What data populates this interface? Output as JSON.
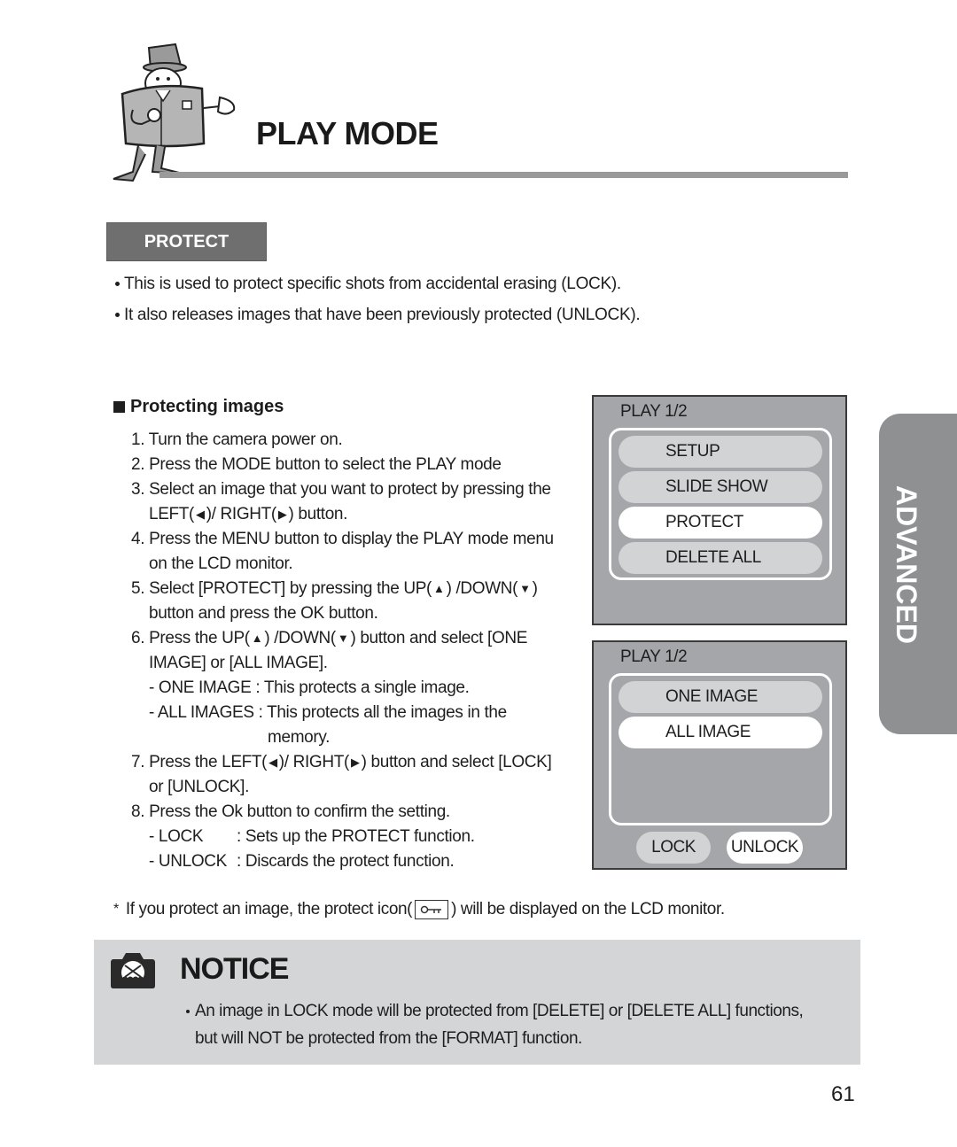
{
  "header": {
    "title": "PLAY MODE",
    "mascot_icon": "camera-mascot-icon"
  },
  "section": {
    "tab_label": "PROTECT",
    "intro": [
      "This is used to protect specific shots from accidental erasing (LOCK).",
      "It also releases images that have been previously protected (UNLOCK)."
    ]
  },
  "procedure": {
    "heading": "Protecting images",
    "steps": {
      "s1": "1. Turn the camera power on.",
      "s2": "2. Press the MODE button to select the PLAY mode",
      "s3a": "3. Select an image that you want to protect by pressing the",
      "s3b_1": "LEFT(",
      "s3b_2": ")/ RIGHT(",
      "s3b_3": ") button.",
      "s4a": "4. Press the MENU button to display the PLAY mode menu",
      "s4b": "on the LCD monitor.",
      "s5a_1": "5. Select [PROTECT] by pressing the UP(",
      "s5a_2": ") /DOWN(",
      "s5a_3": ")",
      "s5b": "button and press the OK button.",
      "s6a_1": "6. Press the UP(",
      "s6a_2": ") /DOWN(",
      "s6a_3": ") button and select [ONE",
      "s6b": "IMAGE] or [ALL IMAGE].",
      "s6c": "- ONE IMAGE : This protects a single image.",
      "s6d": "- ALL IMAGES : This protects all the images in the",
      "s6e": "memory.",
      "s7a_1": "7. Press the LEFT(",
      "s7a_2": ")/ RIGHT(",
      "s7a_3": ") button and select [LOCK]",
      "s7b": "or [UNLOCK].",
      "s8": "8. Press the Ok button to confirm the setting.",
      "s8_lock_key": "- LOCK",
      "s8_lock_val": ": Sets up the PROTECT function.",
      "s8_unlock_key": "- UNLOCK",
      "s8_unlock_val": ": Discards the protect function."
    },
    "glyphs": {
      "left": "◀",
      "right": "▶",
      "up": "▲",
      "down": "▼"
    }
  },
  "lcd_menu": {
    "title": "PLAY 1/2",
    "items": [
      "SETUP",
      "SLIDE SHOW",
      "PROTECT",
      "DELETE ALL"
    ],
    "selected": "PROTECT"
  },
  "lcd_protect": {
    "title": "PLAY 1/2",
    "items": [
      "ONE IMAGE",
      "ALL IMAGE"
    ],
    "selected": "ALL IMAGE",
    "buttons": [
      "LOCK",
      "UNLOCK"
    ],
    "selected_button": "UNLOCK"
  },
  "side_tab": {
    "label": "ADVANCED"
  },
  "footnote": {
    "star": "*",
    "before": "If you protect an image, the protect icon(",
    "after": ") will be displayed on the LCD monitor.",
    "icon": "key-icon"
  },
  "notice": {
    "title": "NOTICE",
    "line1": "An image in LOCK mode will be protected from [DELETE] or [DELETE ALL] functions,",
    "line2": "but will NOT be protected from the [FORMAT] function."
  },
  "page_number": "61",
  "colors": {
    "section_tab": "#6f6f70",
    "lcd_bg": "#a5a6a9",
    "lcd_item": "#d2d3d5",
    "side_tab": "#8e9092",
    "notice_bg": "#d4d5d6",
    "rule": "#9a9a9a"
  }
}
